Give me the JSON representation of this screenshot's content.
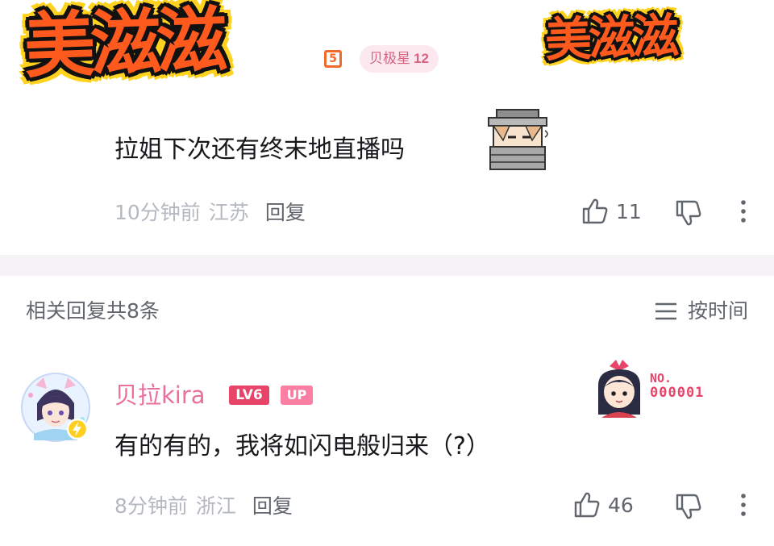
{
  "comment": {
    "decoration_large": "美滋滋",
    "decoration_small": "美滋滋",
    "level_partial": "5",
    "fan_badge": {
      "name": "贝极星",
      "level": "12",
      "color": "#d9637f"
    },
    "text": "拉姐下次还有终末地直播吗",
    "time": "10分钟前",
    "location": "江苏",
    "reply_label": "回复",
    "like_count": "11",
    "icons": [
      "like-icon",
      "dislike-icon",
      "more-icon",
      "sticker-icon"
    ]
  },
  "replies_header": {
    "title": "相关回复共8条",
    "sort_label": "按时间",
    "sort_icon": "menu-lines-icon"
  },
  "reply": {
    "username": "贝拉kira",
    "username_color": "#eb6f9d",
    "level_badge": "LV6",
    "up_badge": "UP",
    "card_label": "NO.",
    "card_number": "000001",
    "text": "有的有的，我将如闪电般归来（?）",
    "time": "8分钟前",
    "location": "浙江",
    "reply_label": "回复",
    "like_count": "46",
    "icons": [
      "avatar",
      "lightning-badge-icon",
      "like-icon",
      "dislike-icon",
      "more-icon"
    ]
  },
  "colors": {
    "accent_pink": "#fb7299",
    "meta_gray": "#b4b8bf",
    "text_dark": "#18191c",
    "divider": "#f6f3f6"
  }
}
